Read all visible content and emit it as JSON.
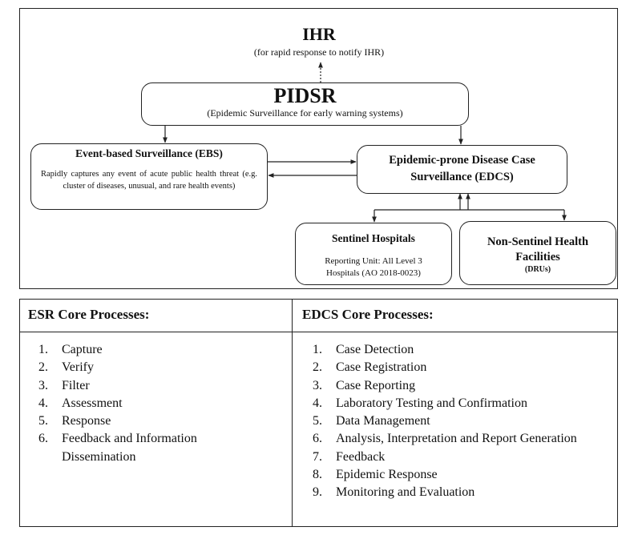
{
  "diagram": {
    "ihr": {
      "title": "IHR",
      "subtitle": "(for rapid response to notify IHR)"
    },
    "pidsr": {
      "title": "PIDSR",
      "subtitle": "(Epidemic Surveillance for early warning systems)"
    },
    "ebs": {
      "title": "Event-based Surveillance (EBS)",
      "description": "Rapidly captures any event of acute public health threat (e.g. cluster of diseases, unusual, and rare health events)"
    },
    "edcs": {
      "title_line1": "Epidemic-prone Disease Case",
      "title_line2": "Surveillance (EDCS)"
    },
    "sentinel": {
      "title": "Sentinel Hospitals",
      "desc_line1": "Reporting Unit: All Level 3",
      "desc_line2": "Hospitals (AO 2018-0023)"
    },
    "non_sentinel": {
      "title_line1": "Non-Sentinel Health",
      "title_line2": "Facilities",
      "subtitle": "(DRUs)"
    }
  },
  "processes": {
    "esr": {
      "header": "ESR Core Processes:",
      "items": [
        {
          "num": "1.",
          "label": "Capture"
        },
        {
          "num": "2.",
          "label": "Verify"
        },
        {
          "num": "3.",
          "label": "Filter"
        },
        {
          "num": "4.",
          "label": "Assessment"
        },
        {
          "num": "5.",
          "label": "Response"
        },
        {
          "num": "6.",
          "label": "Feedback and Information Dissemination"
        }
      ]
    },
    "edcs": {
      "header": "EDCS Core Processes:",
      "items": [
        {
          "num": "1.",
          "label": "Case Detection"
        },
        {
          "num": "2.",
          "label": "Case Registration"
        },
        {
          "num": "3.",
          "label": "Case Reporting"
        },
        {
          "num": "4.",
          "label": "Laboratory Testing and Confirmation"
        },
        {
          "num": "5.",
          "label": "Data Management"
        },
        {
          "num": "6.",
          "label": "Analysis, Interpretation and Report Generation"
        },
        {
          "num": "7.",
          "label": "Feedback"
        },
        {
          "num": "8.",
          "label": "Epidemic Response"
        },
        {
          "num": "9.",
          "label": "Monitoring and Evaluation"
        }
      ]
    }
  }
}
